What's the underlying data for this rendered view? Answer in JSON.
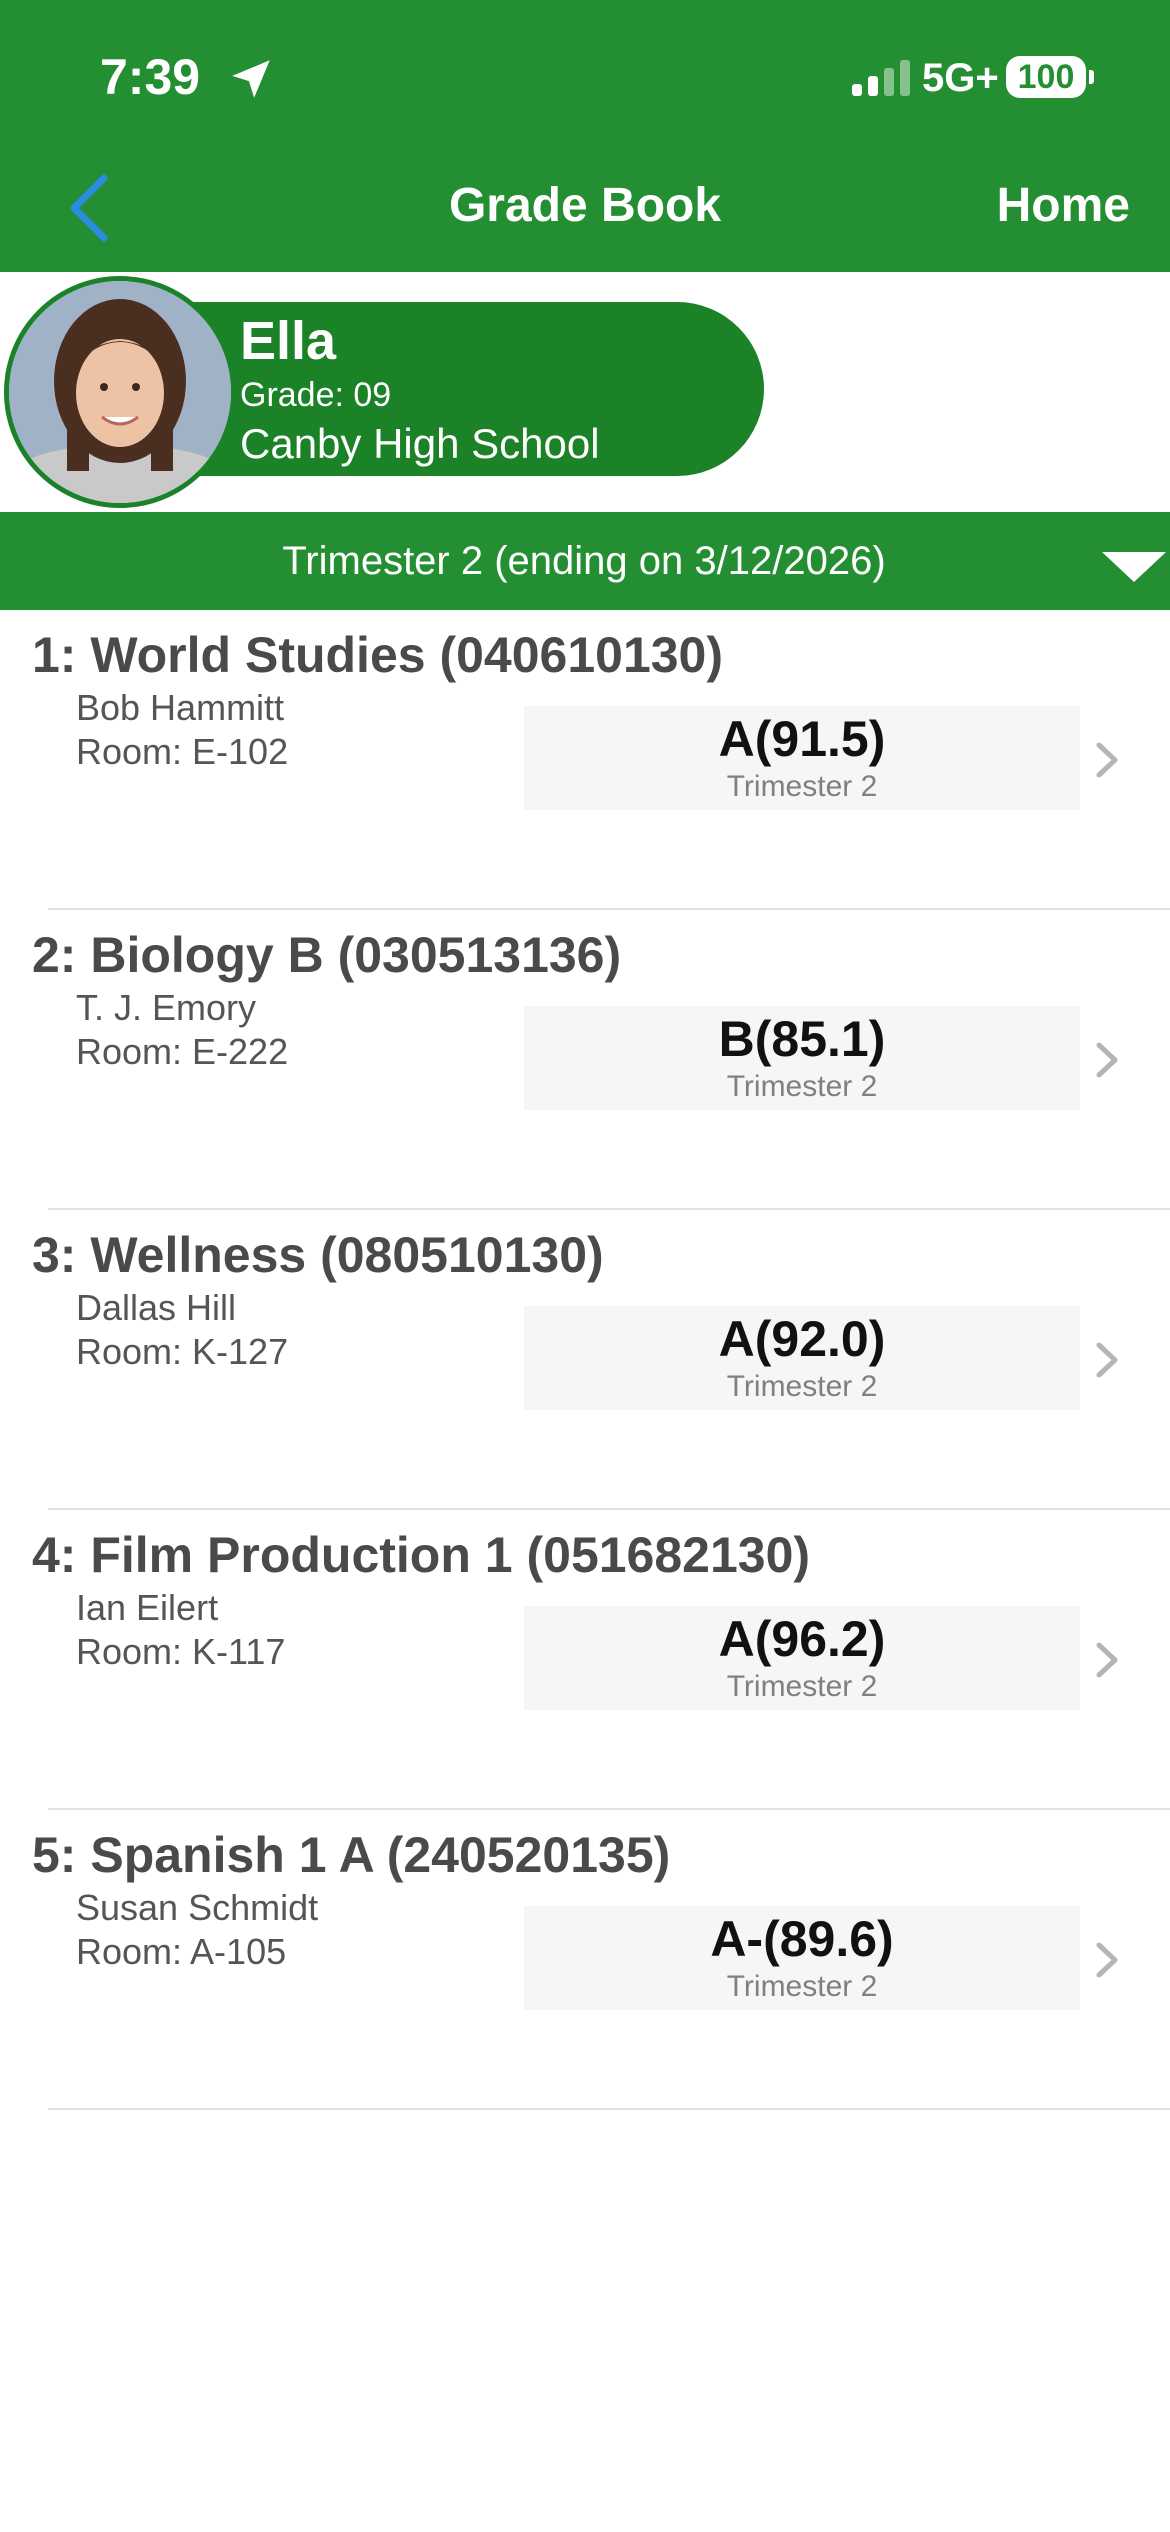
{
  "status_bar": {
    "time": "7:39",
    "network": "5G+",
    "battery": "100"
  },
  "nav": {
    "title": "Grade Book",
    "home_label": "Home"
  },
  "student": {
    "name": "Ella",
    "grade": "Grade: 09",
    "school": "Canby High School"
  },
  "term": {
    "label": "Trimester 2 (ending on 3/12/2026)"
  },
  "courses": [
    {
      "title": "1: World Studies (040610130)",
      "teacher": "Bob Hammitt",
      "room": "Room: E-102",
      "grade": "A(91.5)",
      "term": "Trimester 2"
    },
    {
      "title": "2: Biology B (030513136)",
      "teacher": "T. J. Emory",
      "room": "Room: E-222",
      "grade": "B(85.1)",
      "term": "Trimester 2"
    },
    {
      "title": "3: Wellness (080510130)",
      "teacher": "Dallas Hill",
      "room": "Room: K-127",
      "grade": "A(92.0)",
      "term": "Trimester 2"
    },
    {
      "title": "4: Film Production 1 (051682130)",
      "teacher": "Ian Eilert",
      "room": "Room: K-117",
      "grade": "A(96.2)",
      "term": "Trimester 2"
    },
    {
      "title": "5: Spanish 1 A (240520135)",
      "teacher": "Susan Schmidt",
      "room": "Room: A-105",
      "grade": "A-(89.6)",
      "term": "Trimester 2"
    }
  ],
  "colors": {
    "header_green": "#248f32",
    "card_green": "#1b8227",
    "back_arrow": "#2a8be0"
  },
  "icons": [
    "location-arrow-icon",
    "signal-icon",
    "battery-icon",
    "back-arrow-icon",
    "dropdown-caret-icon",
    "chevron-right-icon"
  ]
}
